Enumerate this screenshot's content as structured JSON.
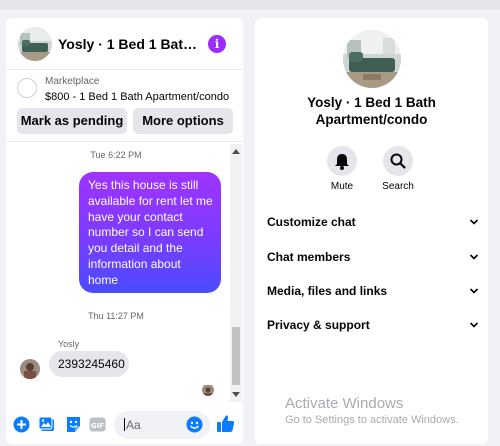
{
  "chat": {
    "title": "Yosly · 1 Bed 1 Bath A...",
    "info_icon": "info-icon"
  },
  "marketplace": {
    "label": "Marketplace",
    "item": "$800 - 1 Bed 1 Bath Apartment/condo",
    "pending_button": "Mark as pending",
    "more_button": "More options"
  },
  "messages": {
    "timestamp_1": "Tue 6:22 PM",
    "outgoing_text": "Yes this house is still available for rent let me have your contact number so I can send you detail and the information about home",
    "timestamp_2": "Thu 11:27 PM",
    "sender_name": "Yosly",
    "incoming_text": "2393245460"
  },
  "composer": {
    "placeholder": "Aa",
    "icons": [
      "add-icon",
      "photo-icon",
      "sticker-icon",
      "gif-icon",
      "emoji-icon",
      "thumbs-up-icon"
    ]
  },
  "info_panel": {
    "name": "Yosly · 1 Bed 1 Bath Apartment/condo",
    "mute_label": "Mute",
    "search_label": "Search",
    "sections": [
      "Customize chat",
      "Chat members",
      "Media, files and links",
      "Privacy & support"
    ]
  },
  "watermark": {
    "line1": "Activate Windows",
    "line2": "Go to Settings to activate Windows."
  },
  "colors": {
    "accent": "#9b2bff",
    "bubble_gradient_top": "#a033ff",
    "bubble_gradient_bottom": "#4a4cff",
    "like_blue": "#0a7cff"
  }
}
